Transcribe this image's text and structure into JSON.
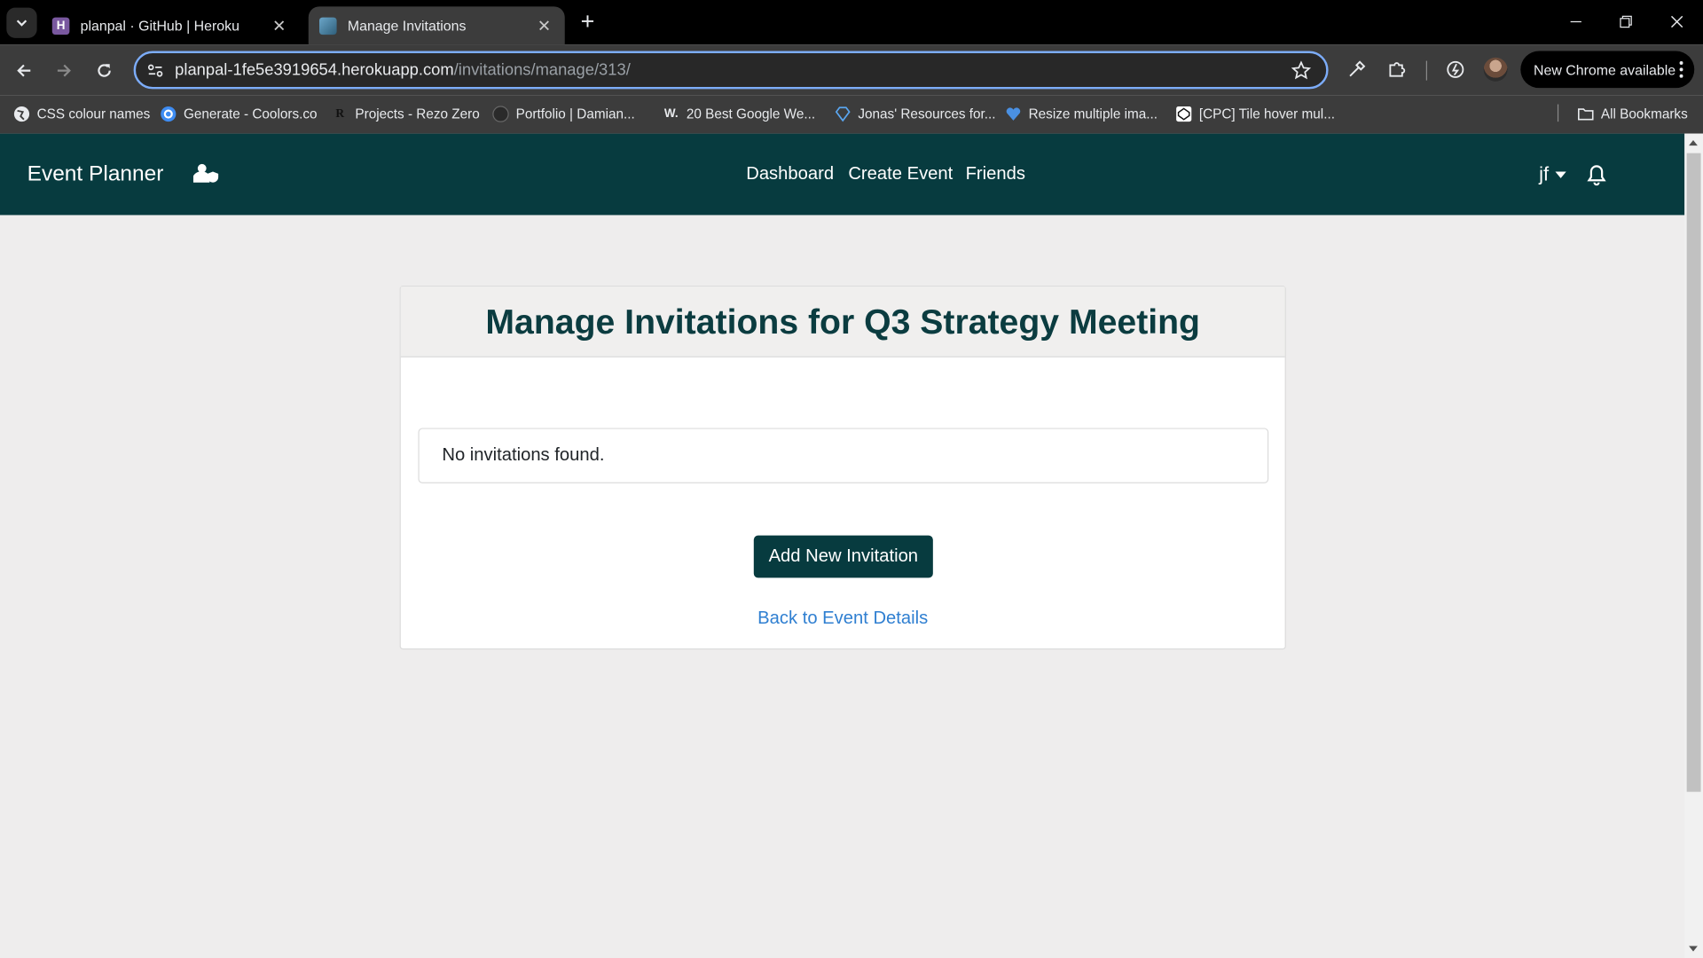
{
  "browser": {
    "tabs": [
      {
        "title": "planpal · GitHub | Heroku",
        "favicon": "heroku-icon",
        "active": false
      },
      {
        "title": "Manage Invitations",
        "favicon": "planner-icon",
        "active": true
      }
    ],
    "address": {
      "host": "planpal-1fe5e3919654.herokuapp.com",
      "path": "/invitations/manage/313/"
    },
    "update_label": "New Chrome available",
    "bookmarks": [
      {
        "label": "CSS colour names",
        "icon": "globe-icon"
      },
      {
        "label": "Generate - Coolors.co",
        "icon": "coolors-icon"
      },
      {
        "label": "Projects - Rezo Zero",
        "icon": "rezo-icon"
      },
      {
        "label": "Portfolio | Damian...",
        "icon": "portfolio-icon"
      },
      {
        "label": "20 Best Google We...",
        "icon": "w-icon"
      },
      {
        "label": "Jonas' Resources for...",
        "icon": "diamond-icon"
      },
      {
        "label": "Resize multiple ima...",
        "icon": "heart-icon"
      },
      {
        "label": "[CPC] Tile hover mul...",
        "icon": "codepen-icon"
      }
    ],
    "all_bookmarks_label": "All Bookmarks"
  },
  "app": {
    "brand": "Event Planner",
    "nav": [
      "Dashboard",
      "Create Event",
      "Friends"
    ],
    "user": "jf"
  },
  "main": {
    "title": "Manage Invitations for Q3 Strategy Meeting",
    "empty_message": "No invitations found.",
    "add_button": "Add New Invitation",
    "back_link": "Back to Event Details"
  },
  "colors": {
    "brand": "#073b3f",
    "link": "#2f7fd1",
    "background": "#eeeded"
  }
}
